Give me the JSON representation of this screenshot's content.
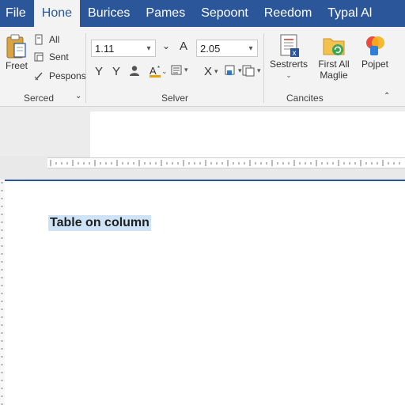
{
  "tabs": [
    {
      "label": "File",
      "active": false
    },
    {
      "label": "Hone",
      "active": true
    },
    {
      "label": "Burices",
      "active": false
    },
    {
      "label": "Pames",
      "active": false
    },
    {
      "label": "Sepoont",
      "active": false
    },
    {
      "label": "Reedom",
      "active": false
    },
    {
      "label": "Typal Al",
      "active": false
    }
  ],
  "ribbon": {
    "clipboard": {
      "paste_label": "Freet",
      "items": [
        "All",
        "Sent",
        "Pespons"
      ],
      "group_label": "Serced"
    },
    "font": {
      "font_name": "1.11",
      "font_size": "2.05",
      "size_letter": "A",
      "group_label": "Selver"
    },
    "editing": {
      "btn1_label": "Sestrerts",
      "btn2_label": "First All Maglie",
      "btn3_label": "Pojpet",
      "group_label": "Cancites"
    }
  },
  "document": {
    "text": "Table on column"
  },
  "colors": {
    "accent": "#2b579a",
    "selection": "#cfe3f6"
  }
}
